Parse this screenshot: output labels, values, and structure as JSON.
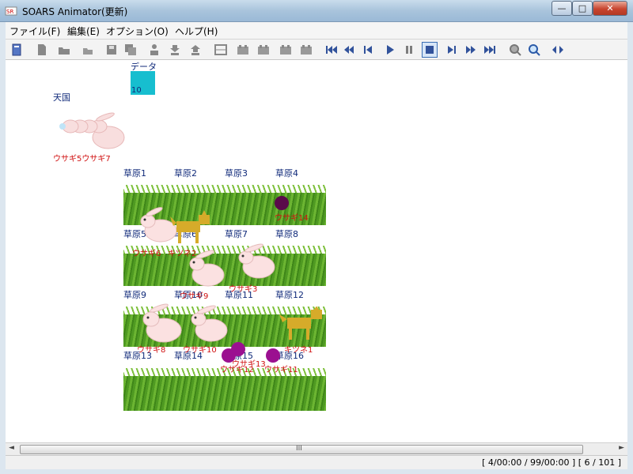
{
  "window": {
    "title": "SOARS Animator(更新)"
  },
  "menu": [
    "ファイル(F)",
    "編集(E)",
    "オプション(O)",
    "ヘルプ(H)"
  ],
  "caption": {
    "min": "—",
    "max": "□",
    "close": "✕"
  },
  "toolbar": {
    "icons": [
      "notebook-icon",
      "page-icon",
      "folder-open-icon",
      "folder-icon",
      "save-icon",
      "save-all-icon",
      "person-down-icon",
      "person-up-icon",
      "grid-icon",
      "grid-add-icon",
      "grid-remove-icon",
      "grid-left-icon",
      "grid-right-icon",
      "skip-first-icon",
      "rewind-icon",
      "step-back-icon",
      "play-icon",
      "pause-icon",
      "stop-icon",
      "step-forward-icon",
      "fast-forward-icon",
      "skip-last-icon",
      "zoom-out-icon",
      "zoom-in-icon",
      "swap-icon"
    ],
    "stop_active": true
  },
  "canvas": {
    "data_box": {
      "label": "データ",
      "value": "10",
      "color": "#17becf"
    },
    "heaven": {
      "label": "天国",
      "occupants": "ウサギ5ウサギ7"
    },
    "grass_color": "#5ea22a",
    "fields": [
      {
        "label": "草原1"
      },
      {
        "label": "草原2"
      },
      {
        "label": "草原3"
      },
      {
        "label": "草原4"
      },
      {
        "label": "草原5"
      },
      {
        "label": "草原6"
      },
      {
        "label": "草原7"
      },
      {
        "label": "草原8"
      },
      {
        "label": "草原9"
      },
      {
        "label": "草原10"
      },
      {
        "label": "草原11"
      },
      {
        "label": "草原12"
      },
      {
        "label": "草原13"
      },
      {
        "label": "草原14"
      },
      {
        "label": "草原15"
      },
      {
        "label": "草原16"
      }
    ],
    "agents": [
      {
        "label": "ウサギ14",
        "kind": "dot",
        "color": "#5a0a4a"
      },
      {
        "label": "ウサギ6",
        "kind": "rabbit"
      },
      {
        "label": "キツネ2",
        "kind": "fox",
        "color": "#d6ab2a"
      },
      {
        "label": "ウサギ3",
        "kind": "rabbit"
      },
      {
        "label": "ウサギ4",
        "kind": "rabbit"
      },
      {
        "label": "ウサギ9",
        "kind": "rabbit"
      },
      {
        "label": "ウサギ8",
        "kind": "rabbit"
      },
      {
        "label": "ウサギ10",
        "kind": "rabbit"
      },
      {
        "label": "キツネ1",
        "kind": "fox",
        "color": "#d6ab2a"
      },
      {
        "label": "ウサギ13",
        "kind": "dot",
        "color": "#9b1090"
      },
      {
        "label": "ウサギ12",
        "kind": "dot",
        "color": "#9b1090"
      },
      {
        "label": "ウサギ11",
        "kind": "dot",
        "color": "#9b1090"
      }
    ]
  },
  "scrollbar": {
    "grip": "III",
    "left": "◄",
    "right": "►"
  },
  "status": "[ 4/00:00 / 99/00:00 ] [ 6 / 101 ]"
}
